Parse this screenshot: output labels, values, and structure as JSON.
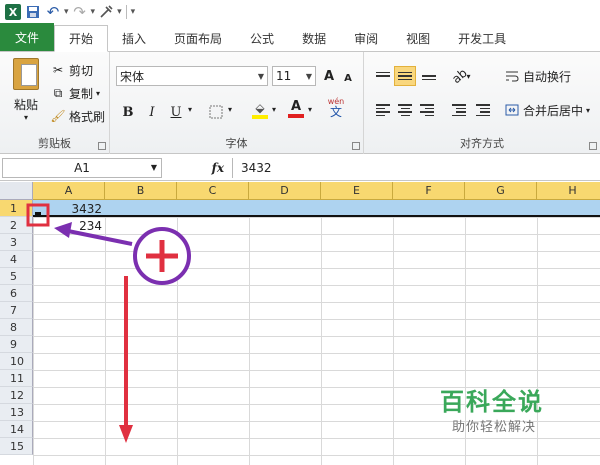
{
  "qat": {
    "undo_glyph": "↶",
    "redo_glyph": "↷"
  },
  "tabs": [
    {
      "label": "文件"
    },
    {
      "label": "开始"
    },
    {
      "label": "插入"
    },
    {
      "label": "页面布局"
    },
    {
      "label": "公式"
    },
    {
      "label": "数据"
    },
    {
      "label": "审阅"
    },
    {
      "label": "视图"
    },
    {
      "label": "开发工具"
    }
  ],
  "clipboard": {
    "paste": "粘贴",
    "cut": "剪切",
    "copy": "复制",
    "format_painter": "格式刷",
    "group_label": "剪贴板"
  },
  "font": {
    "name": "宋体",
    "size": "11",
    "grow": "A",
    "shrink": "A",
    "bold": "B",
    "italic": "I",
    "underline": "U",
    "font_color": "A",
    "wen": "wén",
    "wen_char": "文",
    "group_label": "字体"
  },
  "alignment": {
    "wrap_text": "自动换行",
    "merge_center": "合并后居中",
    "group_label": "对齐方式"
  },
  "formula_bar": {
    "name_box": "A1",
    "fx": "fx",
    "formula": "3432"
  },
  "sheet": {
    "columns": [
      "A",
      "B",
      "C",
      "D",
      "E",
      "F",
      "G",
      "H"
    ],
    "rows": [
      "1",
      "2",
      "3",
      "4",
      "5",
      "6",
      "7",
      "8",
      "9",
      "10",
      "11",
      "12",
      "13",
      "14",
      "15"
    ],
    "cells": {
      "A1": "3432",
      "A2": "234"
    }
  },
  "watermark": {
    "title": "百科全说",
    "subtitle": "助你轻松解决"
  },
  "colors": {
    "file_tab": "#2a8a3d",
    "column_header_selected": "#f8d870",
    "row_selected": "#aed3f0",
    "annotation_purple": "#7b2fb0",
    "annotation_red": "#e03040"
  }
}
